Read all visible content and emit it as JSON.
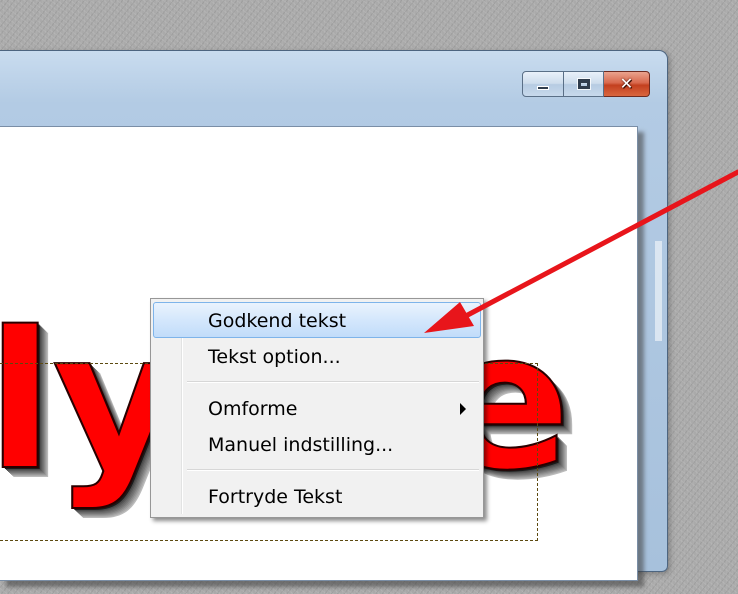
{
  "window": {
    "buttons": {
      "minimize_icon": "minimize-icon",
      "maximize_icon": "maximize-icon",
      "close_glyph": "✕"
    }
  },
  "canvas": {
    "wordart_text": "lykke",
    "wordart_color": "#ff0000"
  },
  "context_menu": {
    "items": [
      {
        "label": "Godkend tekst",
        "highlighted": true
      },
      {
        "label": "Tekst option..."
      },
      {
        "label": "Omforme",
        "has_submenu": true
      },
      {
        "label": "Manuel indstilling..."
      },
      {
        "label": "Fortryde Tekst"
      }
    ]
  },
  "annotation": {
    "arrow_color": "#e8151b",
    "arrow_icon": "red-pointer-arrow-icon"
  }
}
